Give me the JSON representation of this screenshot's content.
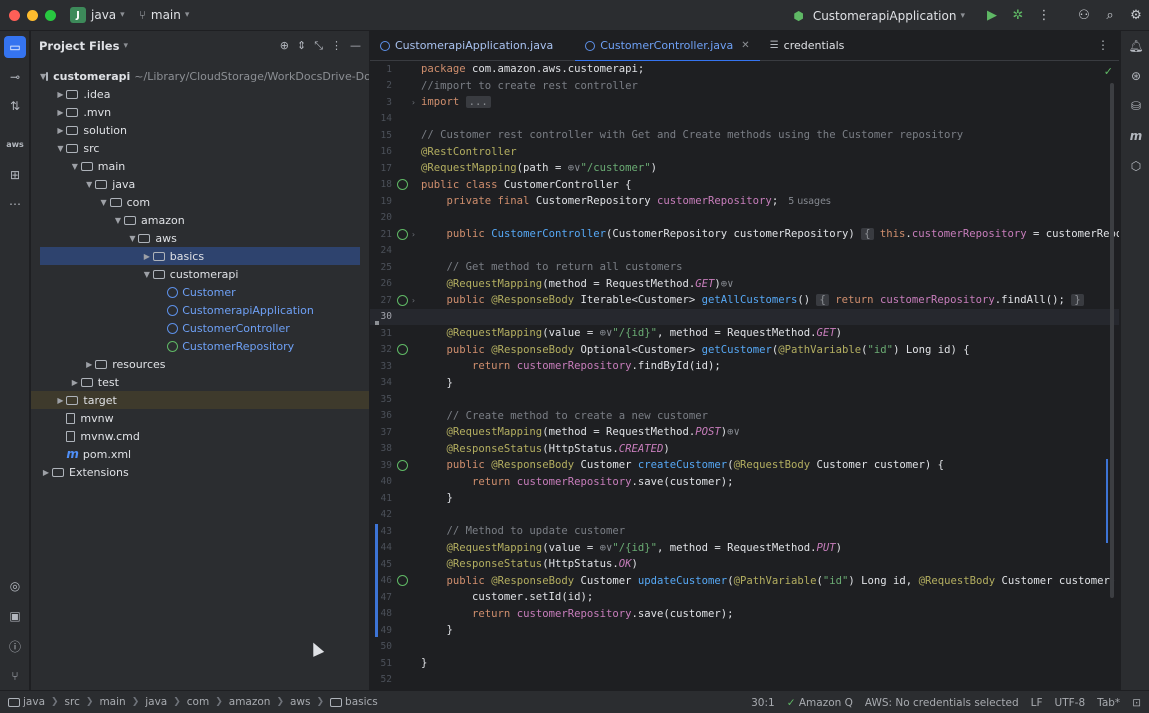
{
  "titlebar": {
    "project_badge": "J",
    "project_name": "java",
    "branch": "main",
    "run_config": "CustomerapiApplication"
  },
  "project_panel": {
    "title": "Project Files",
    "tree": [
      {
        "label": "customerapi",
        "path": "~/Library/CloudStorage/WorkDocsDrive-Document",
        "depth": 0,
        "arrow": "open",
        "icon": "module-folder"
      },
      {
        "label": ".idea",
        "depth": 1,
        "arrow": "closed",
        "icon": "folder"
      },
      {
        "label": ".mvn",
        "depth": 1,
        "arrow": "closed",
        "icon": "folder"
      },
      {
        "label": "solution",
        "depth": 1,
        "arrow": "closed",
        "icon": "folder"
      },
      {
        "label": "src",
        "depth": 1,
        "arrow": "open",
        "icon": "folder"
      },
      {
        "label": "main",
        "depth": 2,
        "arrow": "open",
        "icon": "folder"
      },
      {
        "label": "java",
        "depth": 3,
        "arrow": "open",
        "icon": "folder"
      },
      {
        "label": "com",
        "depth": 4,
        "arrow": "open",
        "icon": "folder"
      },
      {
        "label": "amazon",
        "depth": 5,
        "arrow": "open",
        "icon": "folder"
      },
      {
        "label": "aws",
        "depth": 6,
        "arrow": "open",
        "icon": "folder"
      },
      {
        "label": "basics",
        "depth": 7,
        "arrow": "closed",
        "icon": "folder",
        "selected": true
      },
      {
        "label": "customerapi",
        "depth": 7,
        "arrow": "open",
        "icon": "folder"
      },
      {
        "label": "Customer",
        "depth": 8,
        "arrow": "none",
        "icon": "class"
      },
      {
        "label": "CustomerapiApplication",
        "depth": 8,
        "arrow": "none",
        "icon": "class-app"
      },
      {
        "label": "CustomerController",
        "depth": 8,
        "arrow": "none",
        "icon": "class"
      },
      {
        "label": "CustomerRepository",
        "depth": 8,
        "arrow": "none",
        "icon": "interface"
      },
      {
        "label": "resources",
        "depth": 3,
        "arrow": "closed",
        "icon": "folder"
      },
      {
        "label": "test",
        "depth": 2,
        "arrow": "closed",
        "icon": "folder"
      },
      {
        "label": "target",
        "depth": 1,
        "arrow": "closed",
        "icon": "folder",
        "target": true
      },
      {
        "label": "mvnw",
        "depth": 1,
        "arrow": "none",
        "icon": "file"
      },
      {
        "label": "mvnw.cmd",
        "depth": 1,
        "arrow": "none",
        "icon": "file"
      },
      {
        "label": "pom.xml",
        "depth": 1,
        "arrow": "none",
        "icon": "maven"
      },
      {
        "label": "Extensions",
        "depth": 0,
        "arrow": "closed",
        "icon": "folder"
      }
    ]
  },
  "tabs": [
    {
      "label": "CustomerapiApplication.java",
      "active": false,
      "kind": "class"
    },
    {
      "label": "CustomerController.java",
      "active": true,
      "kind": "class"
    },
    {
      "label": "credentials",
      "active": false,
      "kind": "text"
    }
  ],
  "editor": {
    "lines": [
      {
        "n": "1",
        "html": "<span class='kw'>package</span> com.amazon.aws.customerapi;"
      },
      {
        "n": "2",
        "html": "<span class='cm'>//import to create rest controller</span>"
      },
      {
        "n": "3",
        "html": "<span class='kw'>import</span> <span class='fold-box'>...</span>",
        "fold": true
      },
      {
        "n": "14",
        "html": ""
      },
      {
        "n": "15",
        "html": "<span class='cm'>// Customer rest controller with Get and Create methods using the Customer repository</span>"
      },
      {
        "n": "16",
        "html": "<span class='an'>@RestController</span>"
      },
      {
        "n": "17",
        "html": "<span class='an'>@RequestMapping</span>(path = <span class='globe'>⊕∨</span><span class='st'>\"/customer\"</span>)"
      },
      {
        "n": "18",
        "html": "<span class='kw'>public class</span> CustomerController {",
        "gicon": true
      },
      {
        "n": "19",
        "html": "    <span class='kw'>private final</span> CustomerRepository <span class='fd'>customerRepository</span>;<span class='inline-hint'>5 usages</span>"
      },
      {
        "n": "20",
        "html": ""
      },
      {
        "n": "21",
        "html": "    <span class='kw'>public</span> <span class='fn'>CustomerController</span>(CustomerRepository customerRepository) <span class='fold-box'>{</span> <span class='kw'>this</span>.<span class='fd'>customerRepository</span> = customerRepository; <span class='fold-box'>}</span>",
        "gicon": true,
        "fold": true
      },
      {
        "n": "24",
        "html": ""
      },
      {
        "n": "25",
        "html": "    <span class='cm'>// Get method to return all customers</span>"
      },
      {
        "n": "26",
        "html": "    <span class='an'>@RequestMapping</span>(method = RequestMethod.<span class='it'>GET</span>)<span class='globe'>⊕∨</span>"
      },
      {
        "n": "27",
        "html": "    <span class='kw'>public</span> <span class='an'>@ResponseBody</span> Iterable&lt;Customer&gt; <span class='fn'>getAllCustomers</span>() <span class='fold-box'>{</span> <span class='kw'>return</span> <span class='fd'>customerRepository</span>.findAll(); <span class='fold-box'>}</span>",
        "gicon": true,
        "fold": true
      },
      {
        "n": "30",
        "html": "",
        "current": true
      },
      {
        "n": "31",
        "html": "    <span class='an'>@RequestMapping</span>(value = <span class='globe'>⊕∨</span><span class='st'>\"/{id}\"</span>, method = RequestMethod.<span class='it'>GET</span>)"
      },
      {
        "n": "32",
        "html": "    <span class='kw'>public</span> <span class='an'>@ResponseBody</span> Optional&lt;Customer&gt; <span class='fn'>getCustomer</span>(<span class='an'>@PathVariable</span>(<span class='st'>\"id\"</span>) Long id) {",
        "gicon": true
      },
      {
        "n": "33",
        "html": "        <span class='kw'>return</span> <span class='fd'>customerRepository</span>.findById(id);"
      },
      {
        "n": "34",
        "html": "    }"
      },
      {
        "n": "35",
        "html": ""
      },
      {
        "n": "36",
        "html": "    <span class='cm'>// Create method to create a new customer</span>"
      },
      {
        "n": "37",
        "html": "    <span class='an'>@RequestMapping</span>(method = RequestMethod.<span class='it'>POST</span>)<span class='globe'>⊕∨</span>"
      },
      {
        "n": "38",
        "html": "    <span class='an'>@ResponseStatus</span>(HttpStatus.<span class='it'>CREATED</span>)"
      },
      {
        "n": "39",
        "html": "    <span class='kw'>public</span> <span class='an'>@ResponseBody</span> Customer <span class='fn'>createCustomer</span>(<span class='an'>@RequestBody</span> Customer customer) {",
        "gicon": true
      },
      {
        "n": "40",
        "html": "        <span class='kw'>return</span> <span class='fd'>customerRepository</span>.save(customer);"
      },
      {
        "n": "41",
        "html": "    }"
      },
      {
        "n": "42",
        "html": ""
      },
      {
        "n": "43",
        "html": "    <span class='cm'>// Method to update customer</span>"
      },
      {
        "n": "44",
        "html": "    <span class='an'>@RequestMapping</span>(value = <span class='globe'>⊕∨</span><span class='st'>\"/{id}\"</span>, method = RequestMethod.<span class='it'>PUT</span>)"
      },
      {
        "n": "45",
        "html": "    <span class='an'>@ResponseStatus</span>(HttpStatus.<span class='it'>OK</span>)"
      },
      {
        "n": "46",
        "html": "    <span class='kw'>public</span> <span class='an'>@ResponseBody</span> Customer <span class='fn'>updateCustomer</span>(<span class='an'>@PathVariable</span>(<span class='st'>\"id\"</span>) Long id, <span class='an'>@RequestBody</span> Customer customer) {",
        "gicon": true
      },
      {
        "n": "47",
        "html": "        customer.setId(id);"
      },
      {
        "n": "48",
        "html": "        <span class='kw'>return</span> <span class='fd'>customerRepository</span>.save(customer);"
      },
      {
        "n": "49",
        "html": "    }"
      },
      {
        "n": "50",
        "html": ""
      },
      {
        "n": "51",
        "html": "}"
      },
      {
        "n": "52",
        "html": ""
      }
    ]
  },
  "statusbar": {
    "breadcrumb": [
      "java",
      "src",
      "main",
      "java",
      "com",
      "amazon",
      "aws",
      "basics"
    ],
    "position": "30:1",
    "amazon_q": "Amazon Q",
    "aws_status": "AWS: No credentials selected",
    "line_sep": "LF",
    "encoding": "UTF-8",
    "indent": "Tab*"
  }
}
